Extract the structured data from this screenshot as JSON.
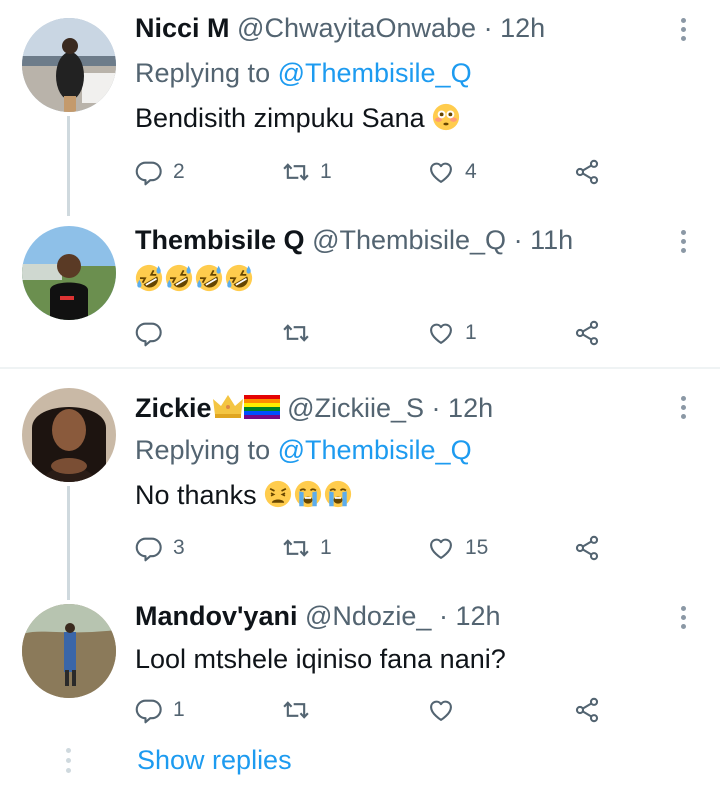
{
  "colors": {
    "text": "#0f1419",
    "muted": "#536471",
    "link": "#1d9bf0",
    "line": "#cfd9de"
  },
  "tweets": [
    {
      "name": "Nicci M",
      "handle": "@ChwayitaOnwabe",
      "sep": "·",
      "time": "12h",
      "replying_label": "Replying to",
      "replying_to": "@Thembisile_Q",
      "text": "Bendisith zimpuku Sana",
      "emojis": [
        "flushed-face"
      ],
      "replies": "2",
      "retweets": "1",
      "likes": "4"
    },
    {
      "name": "Thembisile Q",
      "handle": "@Thembisile_Q",
      "sep": "·",
      "time": "11h",
      "text": "",
      "emojis": [
        "rofl",
        "rofl",
        "rofl",
        "rofl"
      ],
      "replies": "",
      "retweets": "",
      "likes": "1"
    },
    {
      "name": "Zickie",
      "name_flair": [
        "crown",
        "rainbow-flag"
      ],
      "handle": "@Zickiie_S",
      "sep": "·",
      "time": "12h",
      "replying_label": "Replying to",
      "replying_to": "@Thembisile_Q",
      "text": "No thanks",
      "emojis": [
        "weary-face",
        "loudly-crying-face",
        "loudly-crying-face"
      ],
      "replies": "3",
      "retweets": "1",
      "likes": "15"
    },
    {
      "name": "Mandov'yani",
      "handle": "@Ndozie_",
      "sep": "·",
      "time": "12h",
      "text": "Lool mtshele iqiniso fana nani?",
      "replies": "1",
      "retweets": "",
      "likes": ""
    }
  ],
  "show_replies": "Show replies"
}
